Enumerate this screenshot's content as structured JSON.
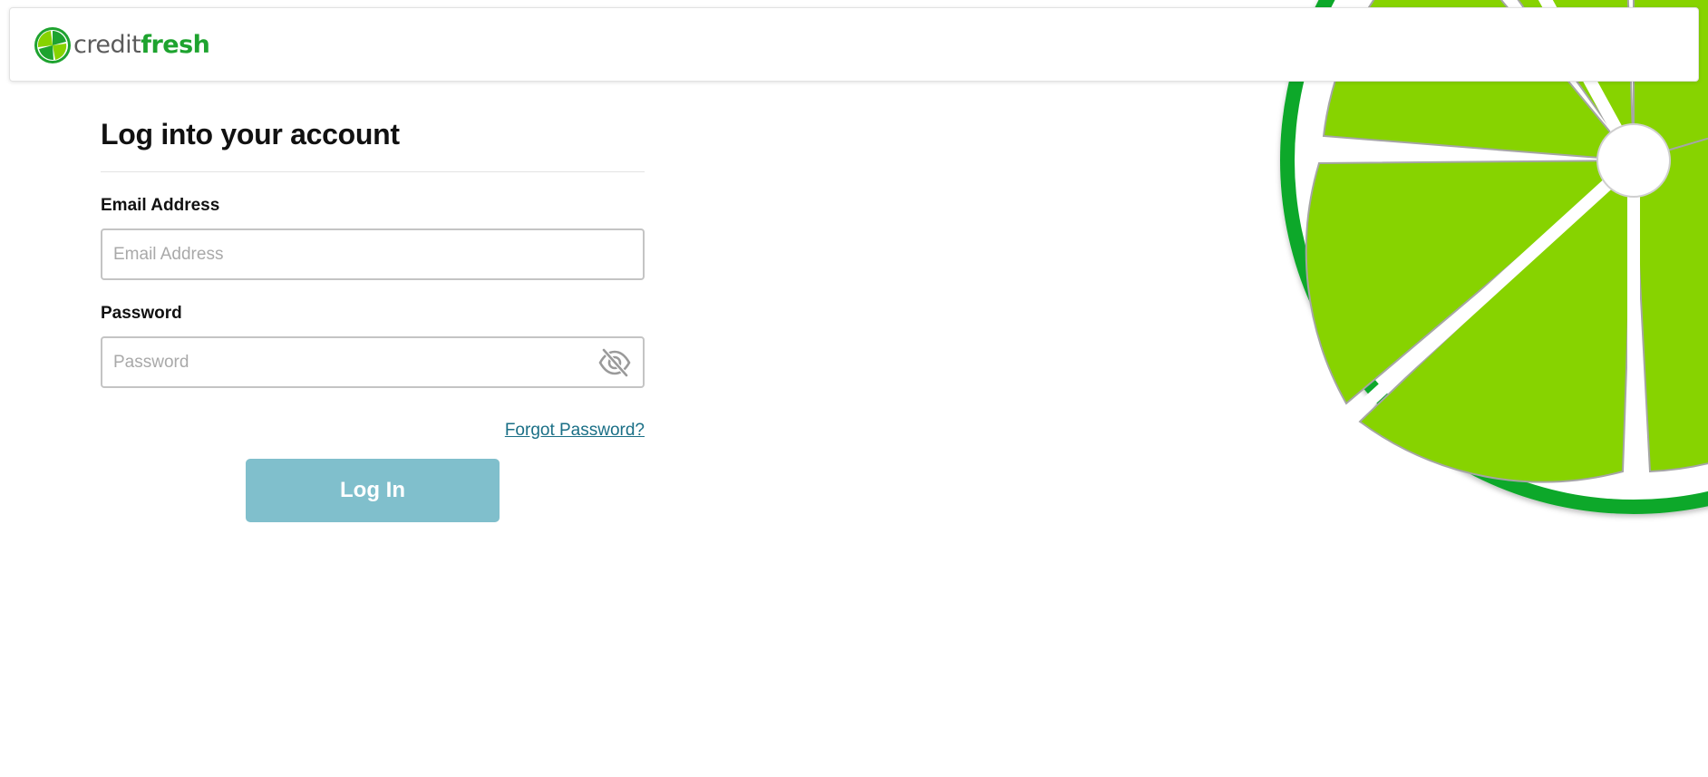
{
  "brand": {
    "name_part1": "credit",
    "name_part2": "fresh",
    "logo_icon": "lime-slice-icon",
    "colors": {
      "green_dark": "#1ea32f",
      "lime": "#87d300",
      "grey_text": "#5b5b5b"
    }
  },
  "login": {
    "title": "Log into your account",
    "email": {
      "label": "Email Address",
      "placeholder": "Email Address",
      "value": ""
    },
    "password": {
      "label": "Password",
      "placeholder": "Password",
      "value": "",
      "toggle_icon": "eye-slash-icon"
    },
    "forgot_label": "Forgot Password?",
    "submit_label": "Log In",
    "colors": {
      "button_bg": "#80bfcc",
      "link": "#1a6f86"
    }
  },
  "background": {
    "decoration_icon": "lime-slice-icon"
  }
}
